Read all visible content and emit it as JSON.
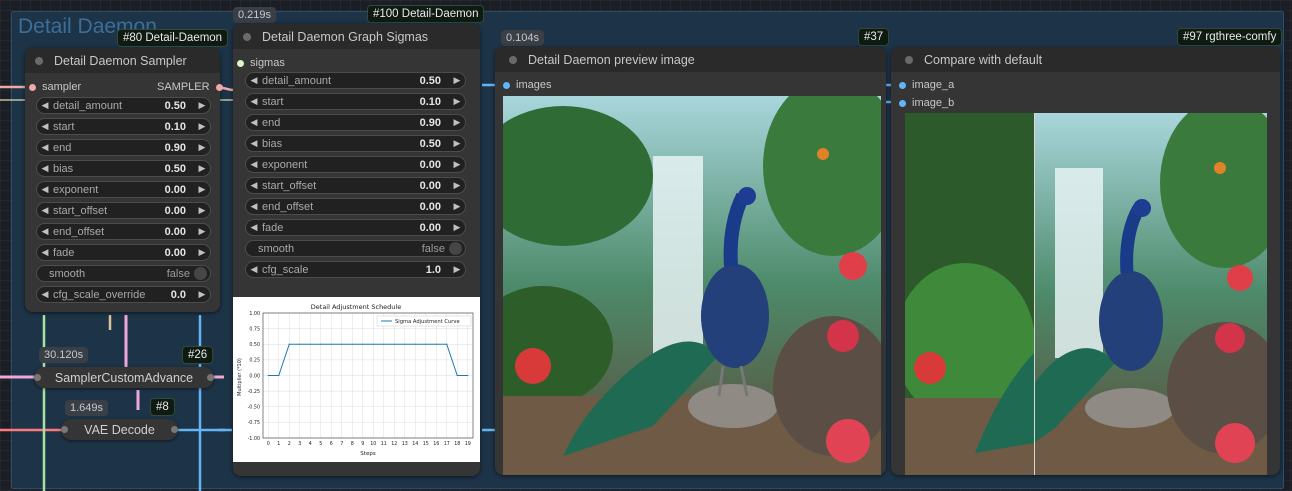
{
  "group": {
    "title": "Detail Daemon"
  },
  "nodes": {
    "sampler": {
      "badge": "#80 Detail-Daemon",
      "title": "Detail Daemon Sampler",
      "input_label": "sampler",
      "output_label": "SAMPLER",
      "widgets": [
        {
          "label": "detail_amount",
          "value": "0.50"
        },
        {
          "label": "start",
          "value": "0.10"
        },
        {
          "label": "end",
          "value": "0.90"
        },
        {
          "label": "bias",
          "value": "0.50"
        },
        {
          "label": "exponent",
          "value": "0.00"
        },
        {
          "label": "start_offset",
          "value": "0.00"
        },
        {
          "label": "end_offset",
          "value": "0.00"
        },
        {
          "label": "fade",
          "value": "0.00"
        }
      ],
      "toggle": {
        "label": "smooth",
        "value": "false"
      },
      "last": {
        "label": "cfg_scale_override",
        "value": "0.0"
      }
    },
    "graph": {
      "time": "0.219s",
      "badge": "#100 Detail-Daemon",
      "title": "Detail Daemon Graph Sigmas",
      "input_label": "sigmas",
      "widgets": [
        {
          "label": "detail_amount",
          "value": "0.50"
        },
        {
          "label": "start",
          "value": "0.10"
        },
        {
          "label": "end",
          "value": "0.90"
        },
        {
          "label": "bias",
          "value": "0.50"
        },
        {
          "label": "exponent",
          "value": "0.00"
        },
        {
          "label": "start_offset",
          "value": "0.00"
        },
        {
          "label": "end_offset",
          "value": "0.00"
        },
        {
          "label": "fade",
          "value": "0.00"
        }
      ],
      "toggle": {
        "label": "smooth",
        "value": "false"
      },
      "last": {
        "label": "cfg_scale",
        "value": "1.0"
      }
    },
    "preview": {
      "time": "0.104s",
      "badge": "#37",
      "title": "Detail Daemon preview image",
      "input_label": "images"
    },
    "compare": {
      "badge": "#97 rgthree-comfy",
      "title": "Compare with default",
      "input_a": "image_a",
      "input_b": "image_b"
    },
    "custom_adv": {
      "time": "30.120s",
      "badge": "#26",
      "title": "SamplerCustomAdvance"
    },
    "vae": {
      "time": "1.649s",
      "badge": "#8",
      "title": "VAE Decode"
    }
  },
  "chart_data": {
    "type": "line",
    "title": "Detail Adjustment Schedule",
    "xlabel": "Steps",
    "ylabel": "Multiplier (*10)",
    "xlim": [
      -0.5,
      19.5
    ],
    "ylim": [
      -1.0,
      1.0
    ],
    "x_ticks": [
      "0",
      "1",
      "2",
      "3",
      "4",
      "5",
      "6",
      "7",
      "8",
      "9",
      "10",
      "11",
      "12",
      "13",
      "14",
      "15",
      "16",
      "17",
      "18",
      "19"
    ],
    "y_ticks": [
      "1.00",
      "0.75",
      "0.50",
      "0.25",
      "0.00",
      "-0.25",
      "-0.50",
      "-0.75",
      "-1.00"
    ],
    "grid": true,
    "legend_position": "top-right",
    "series": [
      {
        "name": "Sigma Adjustment Curve",
        "color": "#1f77b4",
        "x": [
          0,
          1,
          2,
          3,
          4,
          5,
          6,
          7,
          8,
          9,
          10,
          11,
          12,
          13,
          14,
          15,
          16,
          17,
          18,
          19
        ],
        "y": [
          0,
          0,
          0.5,
          0.5,
          0.5,
          0.5,
          0.5,
          0.5,
          0.5,
          0.5,
          0.5,
          0.5,
          0.5,
          0.5,
          0.5,
          0.5,
          0.5,
          0.5,
          0,
          0
        ]
      }
    ]
  }
}
